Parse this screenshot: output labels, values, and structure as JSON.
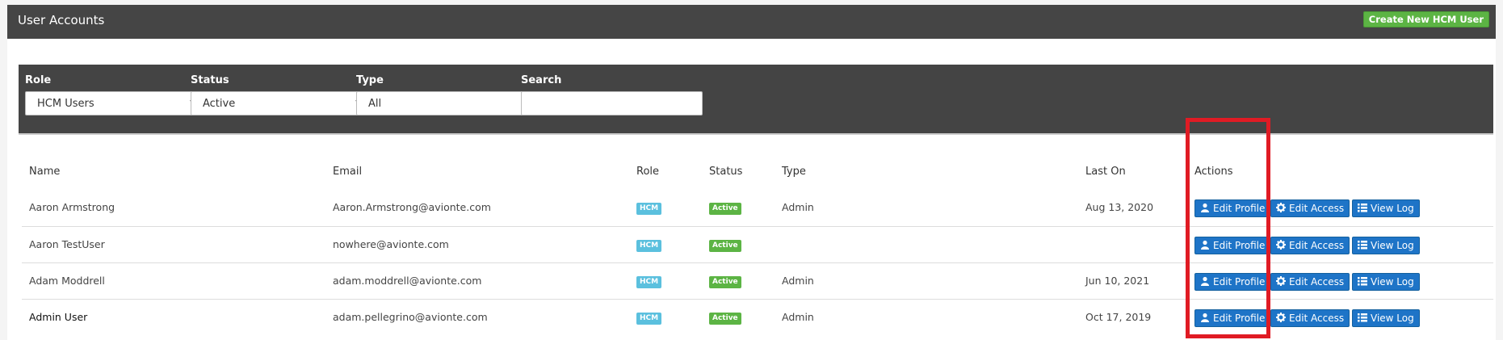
{
  "header": {
    "title": "User Accounts",
    "create_button": "Create New HCM User"
  },
  "filters": {
    "role": {
      "label": "Role",
      "value": "HCM Users"
    },
    "status": {
      "label": "Status",
      "value": "Active"
    },
    "type": {
      "label": "Type",
      "value": "All"
    },
    "search": {
      "label": "Search",
      "value": ""
    }
  },
  "table": {
    "headers": {
      "name": "Name",
      "email": "Email",
      "role": "Role",
      "status": "Status",
      "type": "Type",
      "last_on": "Last On",
      "actions": "Actions"
    },
    "rows": [
      {
        "name": "Aaron Armstrong",
        "email": "Aaron.Armstrong@avionte.com",
        "role": "HCM",
        "status": "Active",
        "type": "Admin",
        "last_on": "Aug 13, 2020"
      },
      {
        "name": "Aaron TestUser",
        "email": "nowhere@avionte.com",
        "role": "HCM",
        "status": "Active",
        "type": "",
        "last_on": ""
      },
      {
        "name": "Adam Moddrell",
        "email": "adam.moddrell@avionte.com",
        "role": "HCM",
        "status": "Active",
        "type": "Admin",
        "last_on": "Jun 10, 2021"
      },
      {
        "name": "Admin User",
        "email": "adam.pellegrino@avionte.com",
        "role": "HCM",
        "status": "Active",
        "type": "Admin",
        "last_on": "Oct 17, 2019"
      }
    ],
    "actions": {
      "edit_profile": "Edit Profile",
      "edit_access": "Edit Access",
      "view_log": "View Log"
    }
  },
  "colors": {
    "header_bg": "#454545",
    "create_green": "#5cb444",
    "action_blue": "#1e74c7",
    "hcm_badge": "#5bc0de",
    "highlight_red": "#e01b24"
  },
  "icons": {
    "edit_profile": "user-icon",
    "edit_access": "gear-icon",
    "view_log": "list-icon",
    "select": "chevron-down-icon"
  }
}
